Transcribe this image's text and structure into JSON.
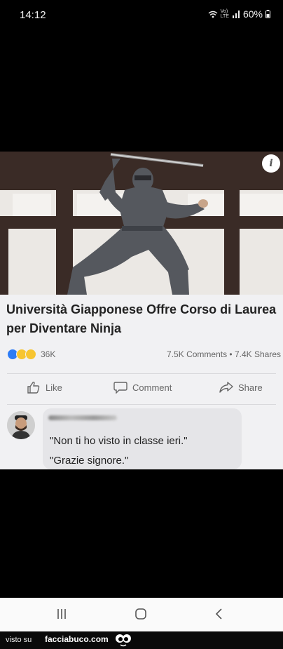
{
  "status_bar": {
    "time": "14:12",
    "network_top": "Vo)",
    "network_bottom": "LTE",
    "battery": "60%"
  },
  "post": {
    "headline_line1": "Università Giapponese Offre Corso di Laurea",
    "headline_line2": "per Diventare Ninja",
    "reaction_count": "36K",
    "share_stats": "7.5K Comments • 7.4K Shares",
    "actions": {
      "like": "Like",
      "comment": "Comment",
      "share": "Share"
    }
  },
  "comment": {
    "line1": "\"Non ti ho visto in classe ieri.\"",
    "line2": "\"Grazie signore.\""
  },
  "footer": {
    "visto_su": "visto su",
    "site": "facciabuco.com"
  },
  "colors": {
    "like_blue": "#2d7cf6",
    "wow_yellow": "#f7c531",
    "bubble": "#e5e5e8"
  }
}
